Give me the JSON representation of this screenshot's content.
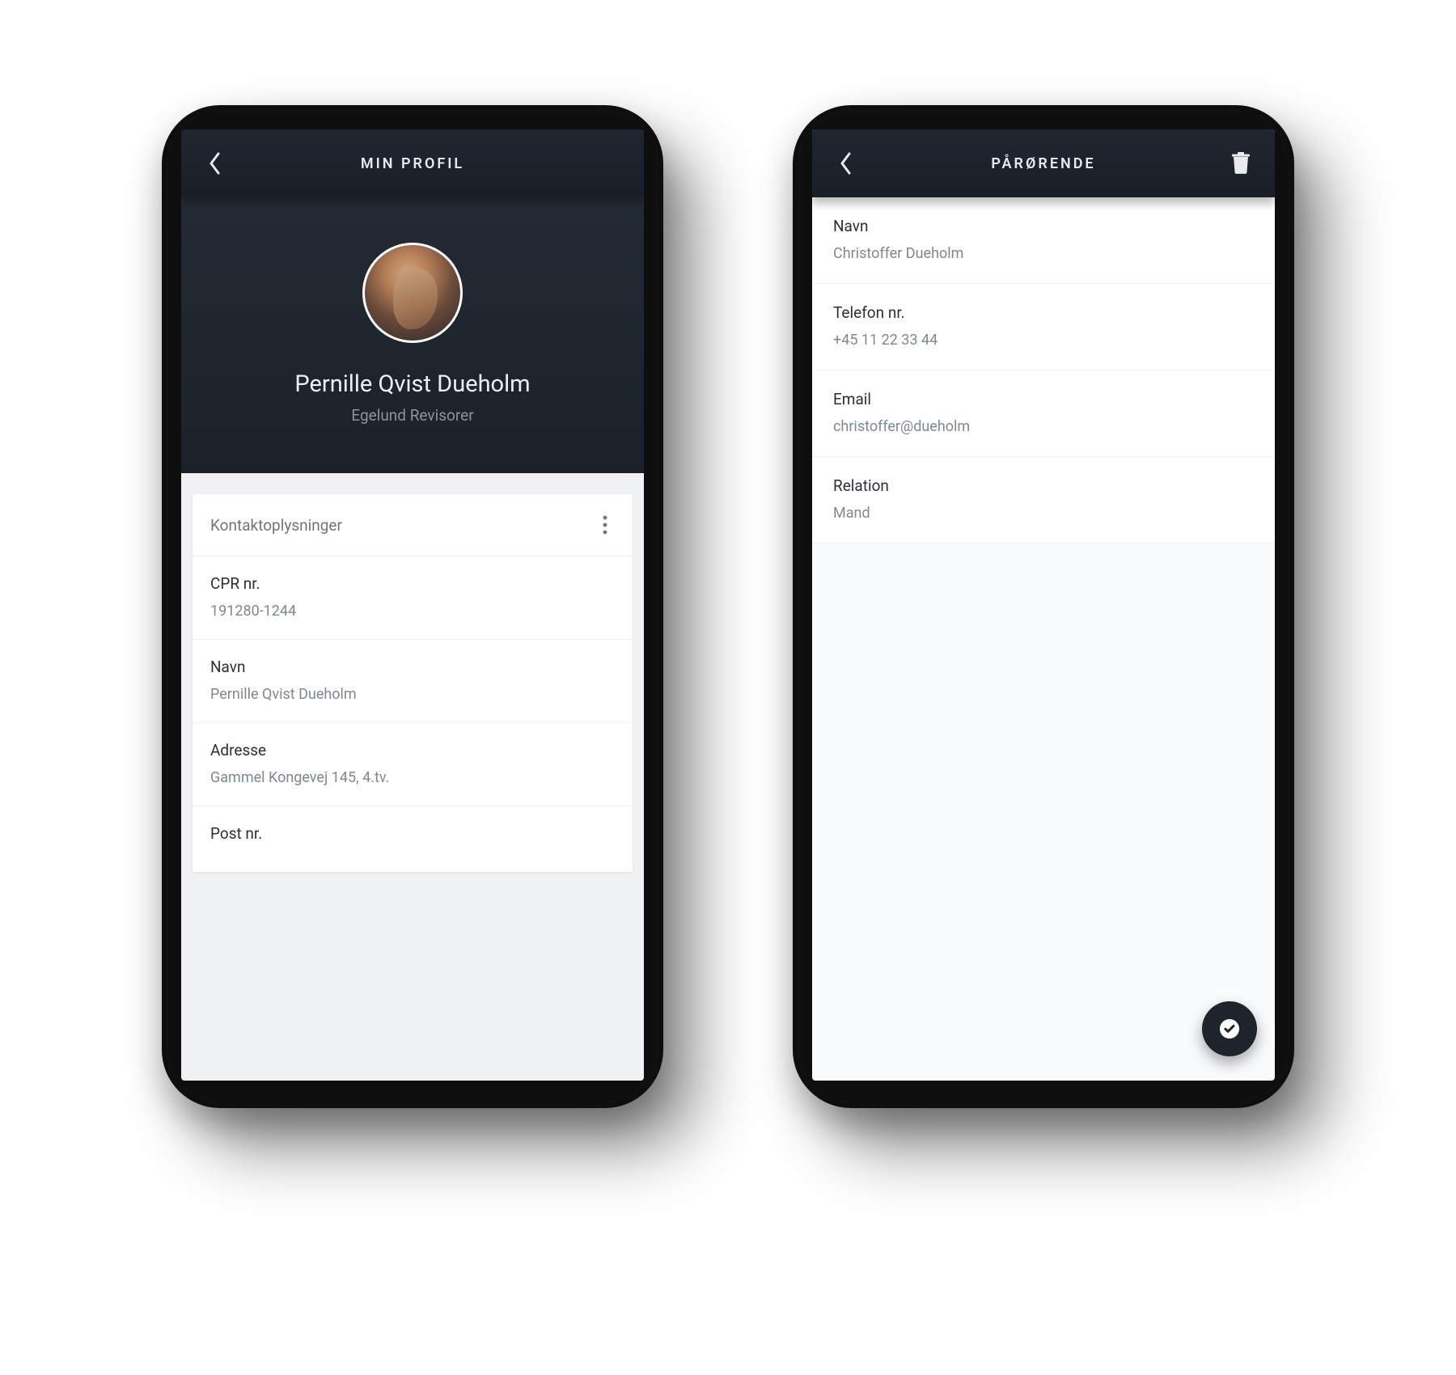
{
  "left": {
    "title": "MIN PROFIL",
    "name": "Pernille Qvist Dueholm",
    "company": "Egelund Revisorer",
    "section_title": "Kontaktoplysninger",
    "fields": {
      "cpr_label": "CPR nr.",
      "cpr_value": "191280-1244",
      "name_label": "Navn",
      "name_value": "Pernille Qvist Dueholm",
      "address_label": "Adresse",
      "address_value": "Gammel Kongevej 145, 4.tv.",
      "post_label": "Post nr."
    }
  },
  "right": {
    "title": "PÅRØRENDE",
    "rows": {
      "name_label": "Navn",
      "name_value": "Christoffer Dueholm",
      "phone_label": "Telefon nr.",
      "phone_value": "+45 11 22 33 44",
      "email_label": "Email",
      "email_value": "christoffer@dueholm",
      "relation_label": "Relation",
      "relation_value": "Mand"
    }
  }
}
